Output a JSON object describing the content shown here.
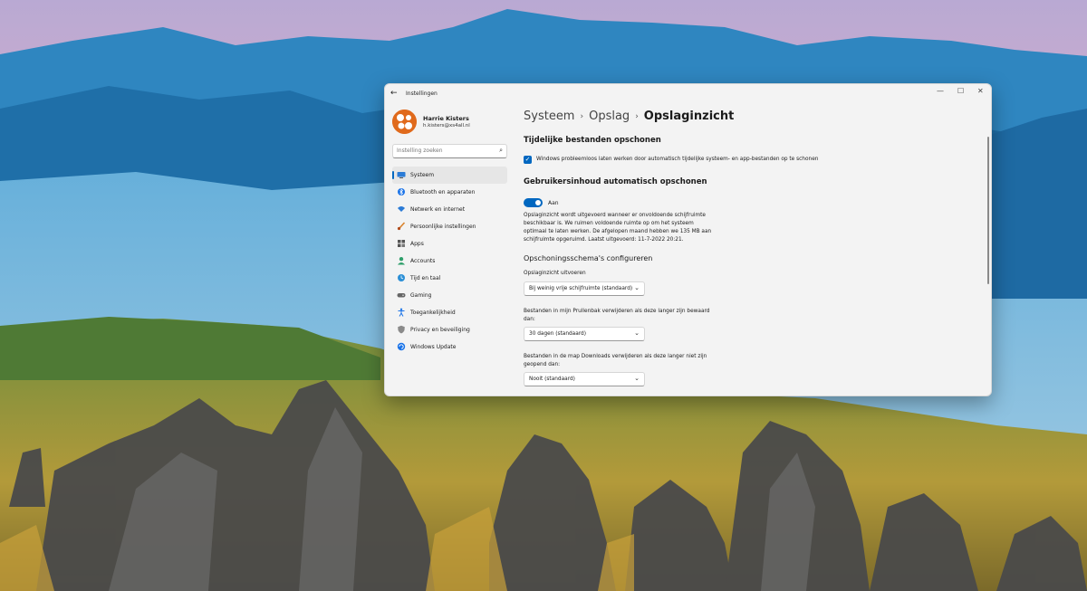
{
  "window": {
    "app_title": "Instellingen",
    "back_icon": "back-arrow-icon",
    "controls": {
      "minimize": "—",
      "maximize": "☐",
      "close": "✕"
    }
  },
  "profile": {
    "name": "Harrie Kisters",
    "email": "h.kisters@xs4all.nl"
  },
  "search": {
    "placeholder": "Instelling zoeken",
    "icon": "search-icon"
  },
  "sidebar": {
    "items": [
      {
        "label": "Systeem",
        "icon": "monitor-icon",
        "active": true
      },
      {
        "label": "Bluetooth en apparaten",
        "icon": "bluetooth-icon"
      },
      {
        "label": "Netwerk en internet",
        "icon": "wifi-icon"
      },
      {
        "label": "Persoonlijke instellingen",
        "icon": "brush-icon"
      },
      {
        "label": "Apps",
        "icon": "apps-icon"
      },
      {
        "label": "Accounts",
        "icon": "person-icon"
      },
      {
        "label": "Tijd en taal",
        "icon": "globe-clock-icon"
      },
      {
        "label": "Gaming",
        "icon": "gamepad-icon"
      },
      {
        "label": "Toegankelijkheid",
        "icon": "accessibility-icon"
      },
      {
        "label": "Privacy en beveiliging",
        "icon": "shield-icon"
      },
      {
        "label": "Windows Update",
        "icon": "windows-update-icon"
      }
    ]
  },
  "breadcrumb": {
    "items": [
      "Systeem",
      "Opslag"
    ],
    "current": "Opslaginzicht",
    "separator": "›"
  },
  "temp_section": {
    "heading": "Tijdelijke bestanden opschonen",
    "checkbox_label": "Windows probleemloos laten werken door automatisch tijdelijke systeem- en app-bestanden op te schonen",
    "checked": true
  },
  "user_section": {
    "heading": "Gebruikersinhoud automatisch opschonen",
    "toggle_label": "Aan",
    "toggle_on": true,
    "description": "Opslaginzicht wordt uitgevoerd wanneer er onvoldoende schijfruimte beschikbaar is. We ruimen voldoende ruimte op om het systeem optimaal te laten werken. De afgelopen maand hebben we 135 MB aan schijfruimte opgeruimd. Laatst uitgevoerd: 11-7-2022 20:21."
  },
  "schedule": {
    "heading": "Opschoningsschema's configureren",
    "run_label": "Opslaginzicht uitvoeren",
    "run_value": "Bij weinig vrije schijfruimte (standaard)",
    "recycle_label": "Bestanden in mijn Prullenbak verwijderen als deze langer zijn bewaard dan:",
    "recycle_value": "30 dagen (standaard)",
    "downloads_label": "Bestanden in de map Downloads verwijderen als deze langer niet zijn geopend dan:",
    "downloads_value": "Nooit (standaard)"
  },
  "colors": {
    "accent": "#0067c0",
    "window_bg": "#f3f3f3",
    "avatar": "#e06a1c"
  }
}
